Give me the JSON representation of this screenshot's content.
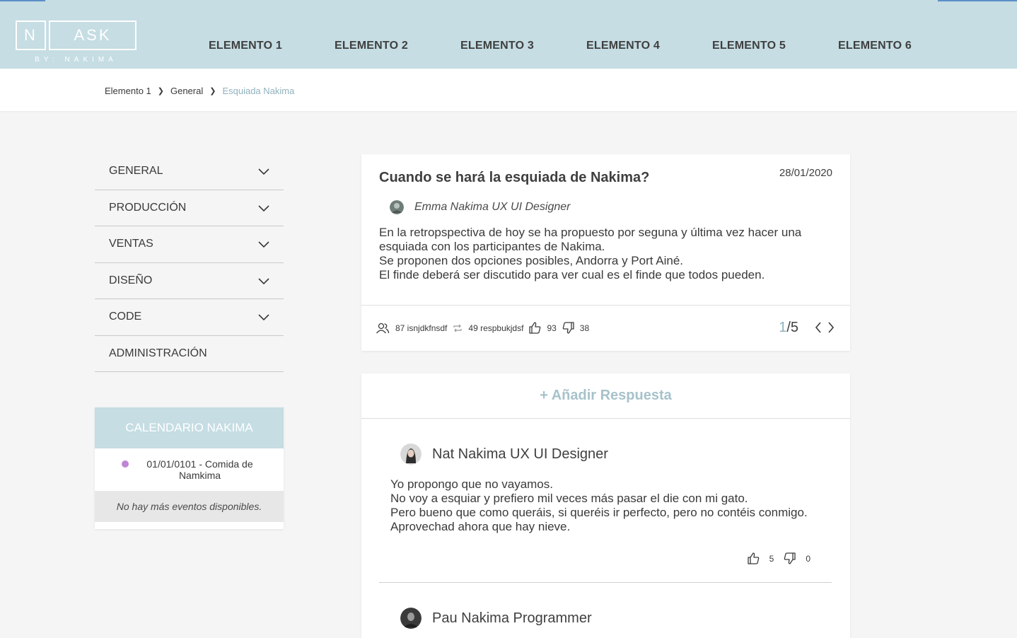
{
  "brand": {
    "logo_n": "N",
    "logo_ask": "ASK",
    "logo_sub": "BY: NAKIMA"
  },
  "nav": [
    "ELEMENTO 1",
    "ELEMENTO 2",
    "ELEMENTO 3",
    "ELEMENTO 4",
    "ELEMENTO 5",
    "ELEMENTO 6"
  ],
  "breadcrumb": [
    "Elemento 1",
    "General",
    "Esquiada Nakima"
  ],
  "sidebar": {
    "items": [
      "GENERAL",
      "PRODUCCIÓN",
      "VENTAS",
      "DISEÑO",
      "CODE",
      "ADMINISTRACIÓN"
    ],
    "calendar": {
      "title": "CALENDARIO NAKIMA",
      "event": "01/01/0101 - Comida de Namkima",
      "empty": "No hay más eventos disponibles.",
      "dot_color": "#c084d6"
    }
  },
  "question": {
    "title": "Cuando se hará la esquiada de Nakima?",
    "date": "28/01/2020",
    "author": "Emma Nakima UX UI Designer",
    "body": [
      "En la retropspectiva de hoy se ha propuesto por seguna y última vez hacer una",
      "esquiada con los participantes de Nakima.",
      "Se proponen dos opciones posibles, Andorra y Port Ainé.",
      "El finde deberá ser discutido para ver cual es el finde que todos pueden."
    ],
    "stats": {
      "followers": "87 isnjdkfnsdf",
      "reposts": "49 respbukjdsf",
      "likes": "93",
      "dislikes": "38"
    },
    "pager": {
      "current": "1",
      "total": "/5"
    }
  },
  "answers": {
    "add_label": "+ Añadir Respuesta",
    "items": [
      {
        "author": "Nat Nakima UX UI Designer",
        "body": [
          "Yo propongo que no vayamos.",
          "No voy a esquiar y prefiero mil veces más pasar el die con mi gato.",
          "Pero bueno que como queráis, si queréis ir perfecto, pero no contéis conmigo.",
          "Aprovechad ahora que hay nieve."
        ],
        "likes": "5",
        "dislikes": "0"
      },
      {
        "author": "Pau Nakima Programmer"
      }
    ]
  },
  "colors": {
    "header_bg": "#c5dde3",
    "accent_text": "#8fb2be",
    "bg": "#f5f5f5"
  }
}
